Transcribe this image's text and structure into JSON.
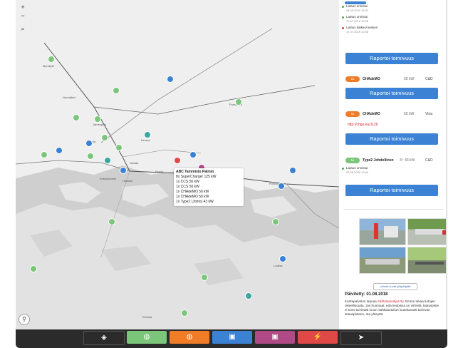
{
  "map": {
    "zoom_in": "+",
    "zoom_out": "−",
    "search": "⌕",
    "user": "⚲",
    "labels": [
      {
        "text": "Myrskylä"
      },
      {
        "text": "Nurmijärvi"
      },
      {
        "text": "Järvenpää"
      },
      {
        "text": "Tuusula"
      },
      {
        "text": "Kerava"
      },
      {
        "text": "Vantaa"
      },
      {
        "text": "Helsinki"
      },
      {
        "text": "Espoo"
      },
      {
        "text": "Kirkkonummi"
      },
      {
        "text": "Sipoo"
      },
      {
        "text": "Porvoo"
      },
      {
        "text": "Loviisa"
      },
      {
        "text": "Pornainen"
      },
      {
        "text": "Ekenäs"
      }
    ],
    "popup": {
      "title": "ABC Tammisto Palmio",
      "lines": [
        "8x SuperCharger 125 kW",
        "1x CCS 50 kW",
        "1x CCS 50 kW",
        "1x CHAdeMO 50 kW",
        "1x CHAdeMO 50 kW",
        "1x Type2 (Johto) 43 kW"
      ]
    }
  },
  "sidebar": {
    "events_top": [
      {
        "label": "Lataus onnistui",
        "date": "04.05.2020 16:31",
        "color": "#4caf50"
      },
      {
        "label": "Lataus onnistui",
        "date": "17.07.2019 12:08",
        "color": "#4caf50"
      },
      {
        "label": "Lataus katkesi kesken",
        "date": "17.07.2019 12:08",
        "color": "#e53935"
      }
    ],
    "report_label": "Raportoi toimivuus",
    "connectors": [
      {
        "count": "1x",
        "name": "CHAdeMO",
        "kw": "50 kW",
        "type": "C&D",
        "color": "#f07c28"
      },
      {
        "count": "1x",
        "name": "CHAdeMO",
        "kw": "50 kW",
        "type": "Virta",
        "color": "#f07c28"
      },
      {
        "count": "1x",
        "name": "Type2 Johdollinen",
        "kw": "3~ 43 kW",
        "type": "C&D",
        "color": "#7bc67b"
      }
    ],
    "link_text": "http://chge.eu/1126",
    "event_bottom": {
      "label": "Lataus onnistui",
      "date": "23.09.2020 19:44",
      "color": "#4caf50"
    },
    "more_photos": "Lähetä kuvat ylläpitäjälle",
    "updated": "Päivitetty: 01.08.2018",
    "note_a": "Karttapalvelun tarjoaa ",
    "note_link": "Sähköautoilijat Ry",
    "note_b": ". Emme takaa tietojen oikeellisuutta. Jos huomaat, että tiedoissa on virheitä, latauspiste ei toimi tai tiedät muun sähköautoilun luotettavasti toimivan latauspisteen, ota yhteyttä"
  },
  "toolbar": {
    "buttons": [
      {
        "name": "layers",
        "glyph": "◈",
        "color": "#2b2b2b"
      },
      {
        "name": "green-filter",
        "glyph": "◍",
        "color": "#7bc67b"
      },
      {
        "name": "orange-filter",
        "glyph": "◍",
        "color": "#f07c28"
      },
      {
        "name": "blue-filter",
        "glyph": "▣",
        "color": "#3b82d4"
      },
      {
        "name": "purple-filter",
        "glyph": "▣",
        "color": "#b04a86"
      },
      {
        "name": "red-filter",
        "glyph": "⚡",
        "color": "#e04848"
      },
      {
        "name": "locate",
        "glyph": "➤",
        "color": "#2b2b2b"
      }
    ]
  }
}
